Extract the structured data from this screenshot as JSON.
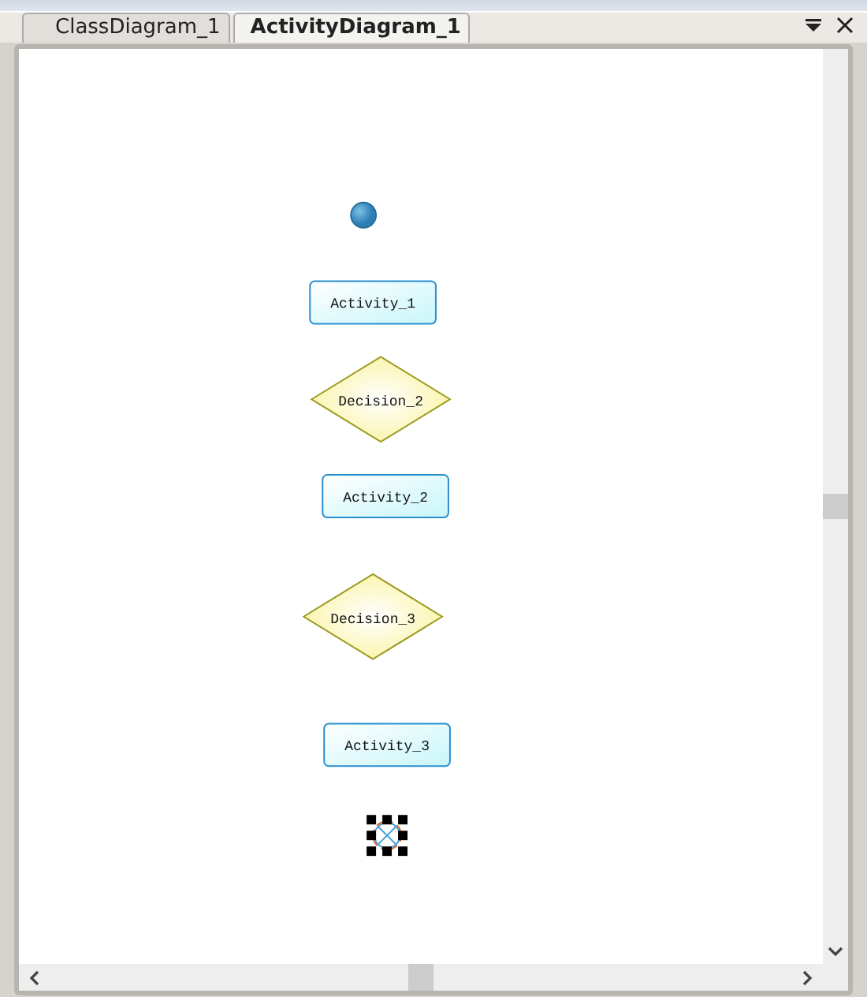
{
  "tabs": [
    {
      "label": "ClassDiagram_1",
      "selected": false
    },
    {
      "label": "ActivityDiagram_1",
      "selected": true
    }
  ],
  "diagram": {
    "nodes": [
      {
        "kind": "initial",
        "selected": false
      },
      {
        "kind": "activity",
        "label": "Activity_1",
        "selected": false
      },
      {
        "kind": "decision",
        "label": "Decision_2",
        "selected": false
      },
      {
        "kind": "activity",
        "label": "Activity_2",
        "selected": false
      },
      {
        "kind": "decision",
        "label": "Decision_3",
        "selected": false
      },
      {
        "kind": "activity",
        "label": "Activity_3",
        "selected": false
      },
      {
        "kind": "final",
        "selected": true
      }
    ]
  }
}
